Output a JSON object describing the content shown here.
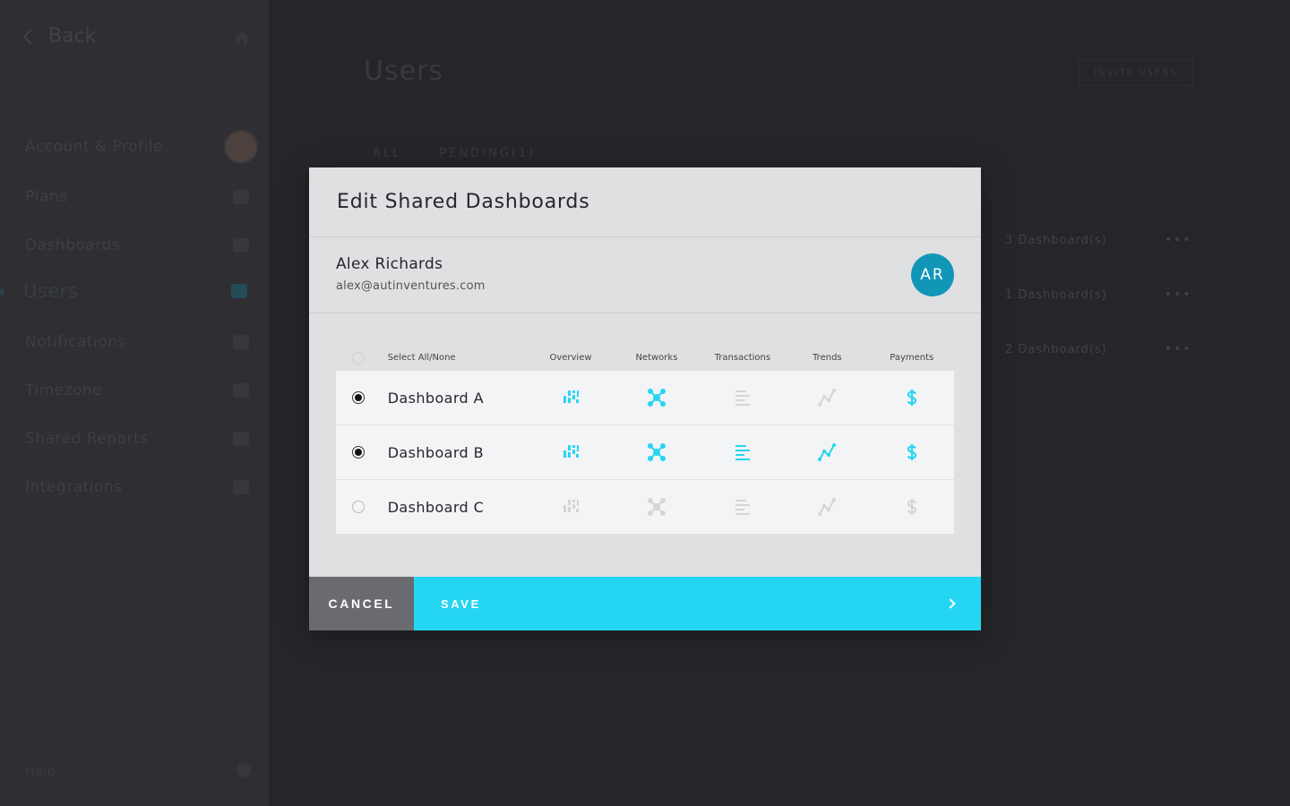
{
  "sidebar": {
    "back_label": "Back",
    "items": [
      {
        "label": "Account & Profile",
        "icon": "avatar"
      },
      {
        "label": "Plans",
        "icon": "book-icon"
      },
      {
        "label": "Dashboards",
        "icon": "grid-icon"
      },
      {
        "label": "Users",
        "icon": "users-icon",
        "active": true
      },
      {
        "label": "Notifications",
        "icon": "bell-icon"
      },
      {
        "label": "Timezone",
        "icon": "clock-icon"
      },
      {
        "label": "Shared Reports",
        "icon": "report-icon"
      },
      {
        "label": "Integrations",
        "icon": "plug-icon"
      }
    ],
    "help_label": "Help"
  },
  "main": {
    "title": "Users",
    "invite_label": "INVITE USERS",
    "tabs": [
      "ALL",
      "PENDING(1)"
    ],
    "rows": [
      {
        "count": "3 Dashboard(s)",
        "menu": "•••"
      },
      {
        "count": "1 Dashboard(s)",
        "menu": "•••"
      },
      {
        "count": "2 Dashboard(s)",
        "menu": "•••"
      }
    ]
  },
  "modal": {
    "title": "Edit Shared Dashboards",
    "user": {
      "name": "Alex Richards",
      "email": "alex@autinventures.com",
      "initials": "AR",
      "avatar_color": "#1296b8"
    },
    "select_all_label": "Select All/None",
    "columns": [
      "Overview",
      "Networks",
      "Transactions",
      "Trends",
      "Payments"
    ],
    "dashboards": [
      {
        "name": "Dashboard A",
        "selected": true,
        "access": {
          "Overview": true,
          "Networks": true,
          "Transactions": false,
          "Trends": false,
          "Payments": true
        }
      },
      {
        "name": "Dashboard B",
        "selected": true,
        "access": {
          "Overview": true,
          "Networks": true,
          "Transactions": true,
          "Trends": true,
          "Payments": true
        }
      },
      {
        "name": "Dashboard C",
        "selected": false,
        "access": {
          "Overview": false,
          "Networks": false,
          "Transactions": false,
          "Trends": false,
          "Payments": false
        }
      }
    ],
    "cancel_label": "CANCEL",
    "save_label": "SAVE",
    "colors": {
      "active_icon": "#25d6f2",
      "inactive_icon": "#d4d5d7",
      "save_bg": "#25d6f2",
      "cancel_bg": "#696b70"
    }
  }
}
